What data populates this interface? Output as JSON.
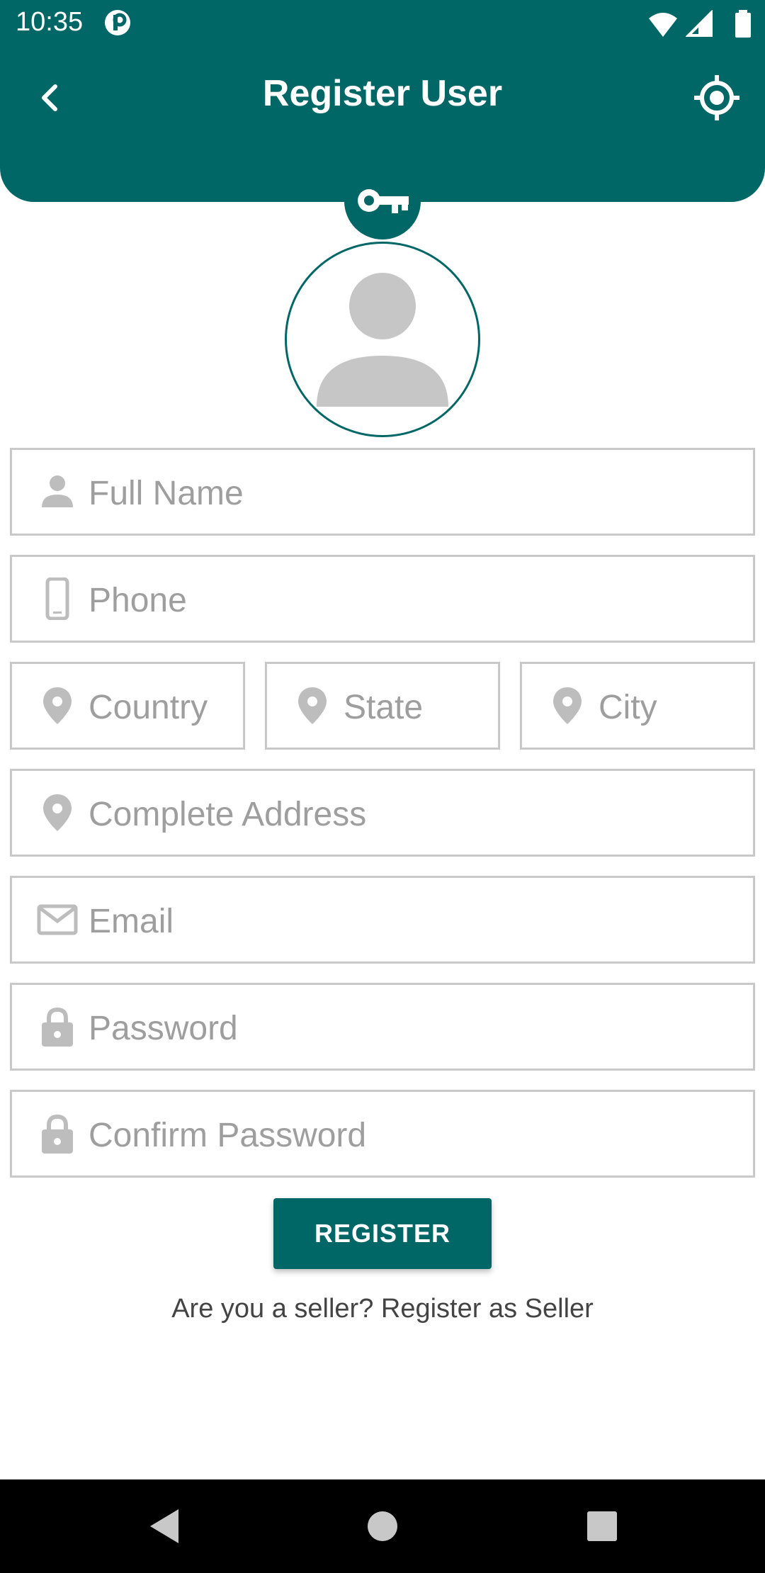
{
  "status_bar": {
    "time": "10:35"
  },
  "header": {
    "title": "Register User",
    "back_icon": "chevron-left-icon",
    "location_icon": "gps-target-icon",
    "badge_icon": "key-icon"
  },
  "form": {
    "full_name_placeholder": "Full Name",
    "phone_placeholder": "Phone",
    "country_placeholder": "Country",
    "state_placeholder": "State",
    "city_placeholder": "City",
    "address_placeholder": "Complete Address",
    "email_placeholder": "Email",
    "password_placeholder": "Password",
    "confirm_password_placeholder": "Confirm Password"
  },
  "actions": {
    "register_label": "REGISTER",
    "seller_link": "Are you a seller? Register as Seller"
  },
  "colors": {
    "primary": "#006766",
    "border": "#c9c9c9",
    "placeholder": "#9e9e9e",
    "icon": "#bdbdbd"
  }
}
